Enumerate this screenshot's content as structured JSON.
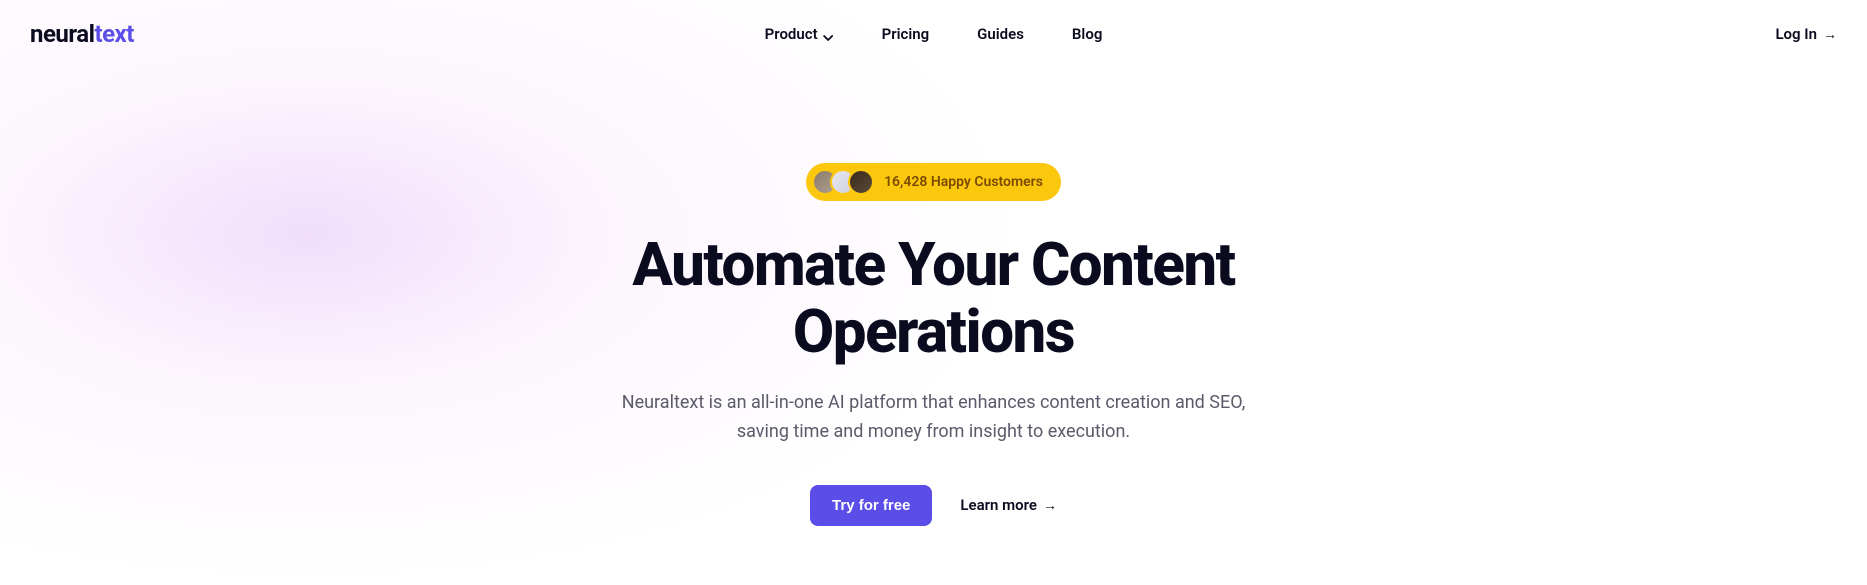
{
  "brand": {
    "part1": "neural",
    "part2": "text"
  },
  "nav": {
    "product": "Product",
    "pricing": "Pricing",
    "guides": "Guides",
    "blog": "Blog"
  },
  "login": "Log In",
  "badge": {
    "text": "16,428 Happy Customers"
  },
  "hero": {
    "title_line1": "Automate Your Content",
    "title_line2": "Operations",
    "subtitle": "Neuraltext is an all-in-one AI platform that enhances content creation and SEO, saving time and money from insight to execution."
  },
  "cta": {
    "primary": "Try for free",
    "secondary": "Learn more"
  }
}
